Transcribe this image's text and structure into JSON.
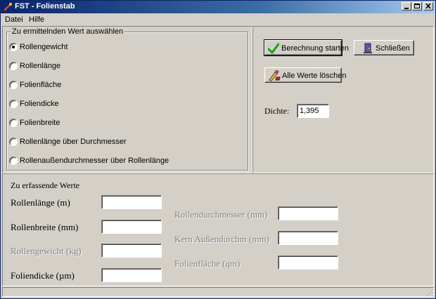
{
  "window": {
    "title": "FST - Folienstab"
  },
  "menu": {
    "items": [
      "Datei",
      "Hilfe"
    ]
  },
  "select_group": {
    "legend": "Zu ermittelnden Wert auswählen",
    "options": [
      "Rollengewicht",
      "Rollenlänge",
      "Folienfläche",
      "Foliendicke",
      "Folienbreite",
      "Rollenlänge über Durchmesser",
      "Rollenaußendurchmesser über Rollenlänge"
    ],
    "selected": 0
  },
  "buttons": {
    "calculate": "Berechnung starten",
    "close": "Schließen",
    "clear_all": "Alle Werte löschen"
  },
  "density": {
    "label": "Dichte:",
    "value": "1,395"
  },
  "inputs": {
    "heading": "Zu erfassende Werte",
    "left": [
      {
        "label": "Rollenlänge (m)",
        "value": ""
      },
      {
        "label": "Rollenbreite (mm)",
        "value": ""
      },
      {
        "label": "Rollengewicht (kg)",
        "value": ""
      },
      {
        "label": "Foliendicke (µm)",
        "value": ""
      }
    ],
    "right": [
      {
        "label": "Rollendurchmesser (mm)",
        "value": ""
      },
      {
        "label": "Kern Außendurchm (mm)",
        "value": ""
      },
      {
        "label": "Folienfläche (qm)",
        "value": ""
      }
    ]
  },
  "colors": {
    "titlebar_start": "#0a246a",
    "titlebar_end": "#a6caf0",
    "face": "#d4d0c8",
    "disabled_text": "#808080"
  },
  "icons": {
    "app": "fst-app-icon",
    "calculate": "green-check-icon",
    "close": "door-exit-icon",
    "clear_all": "eraser-pencil-icon"
  }
}
